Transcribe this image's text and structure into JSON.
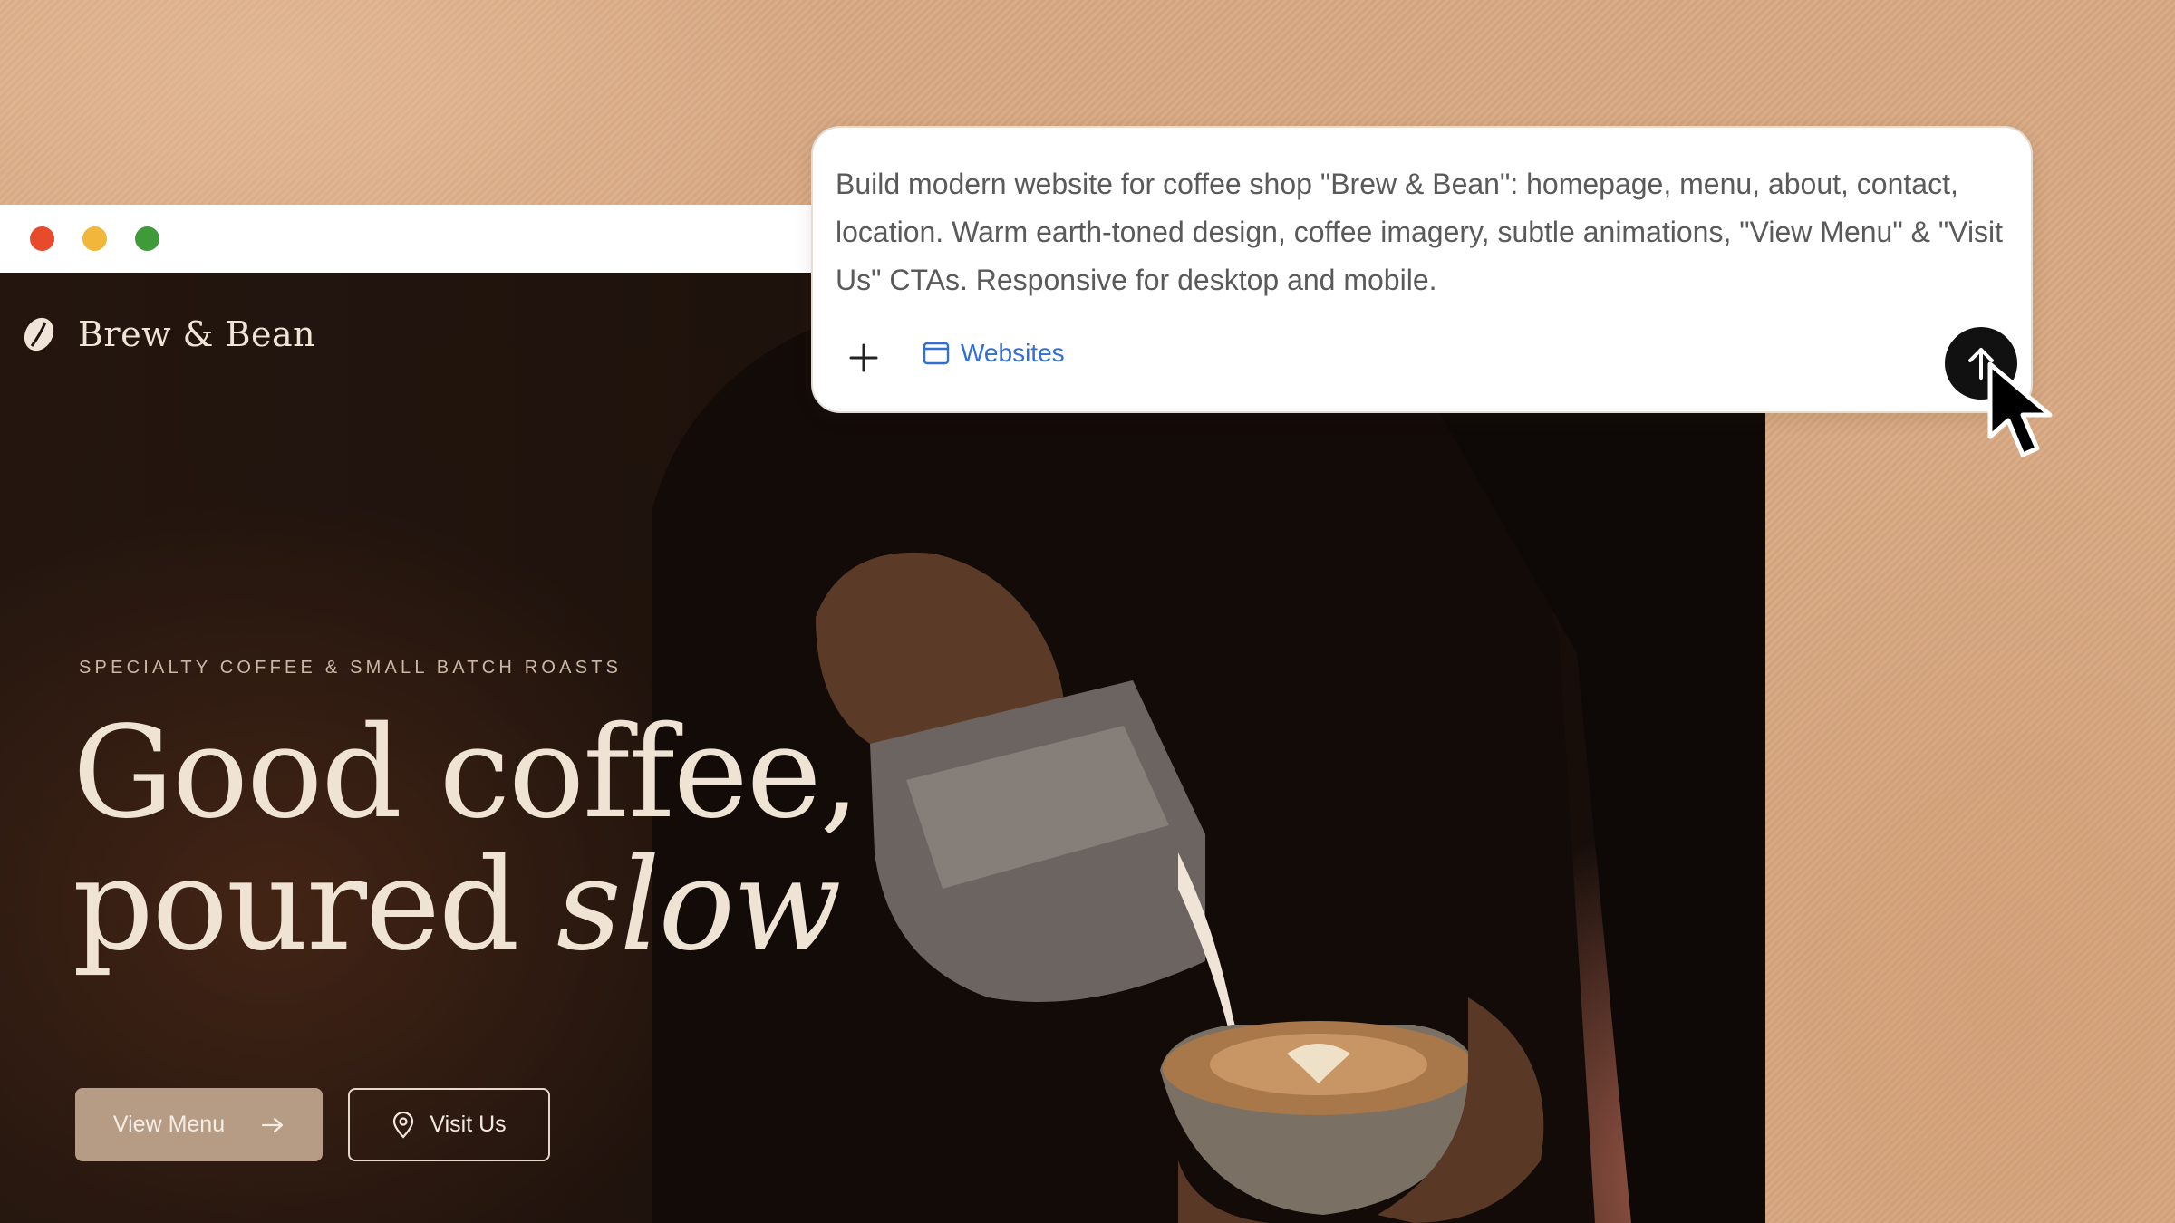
{
  "prompt": {
    "text": "Build modern website for coffee shop \"Brew & Bean\": homepage, menu, about, contact, location. Warm earth-toned design, coffee imagery, subtle animations, \"View Menu\" & \"Visit Us\" CTAs. Responsive for desktop and mobile.",
    "chip_label": "Websites",
    "icons": {
      "add": "plus-icon",
      "chip": "browser-window-icon",
      "send": "arrow-up-icon"
    }
  },
  "site": {
    "brand": "Brew & Bean",
    "eyebrow": "SPECIALTY COFFEE & SMALL BATCH ROASTS",
    "headline_line1": "Good coffee,",
    "headline_line2_regular": "poured ",
    "headline_line2_italic": "slow",
    "primary_cta": "View Menu",
    "secondary_cta": "Visit Us",
    "icons": {
      "logo": "coffee-bean-icon",
      "primary": "arrow-right-icon",
      "secondary": "map-pin-icon"
    }
  },
  "colors": {
    "background": "#d8a982",
    "site_bg": "#1d120d",
    "headline": "#efe3d4",
    "primary_button": "#b79c85",
    "chip_text": "#2f6fd6",
    "send_button": "#111111",
    "traffic_red": "#e84a2c",
    "traffic_yellow": "#f1b63a",
    "traffic_green": "#3f9b3a"
  }
}
